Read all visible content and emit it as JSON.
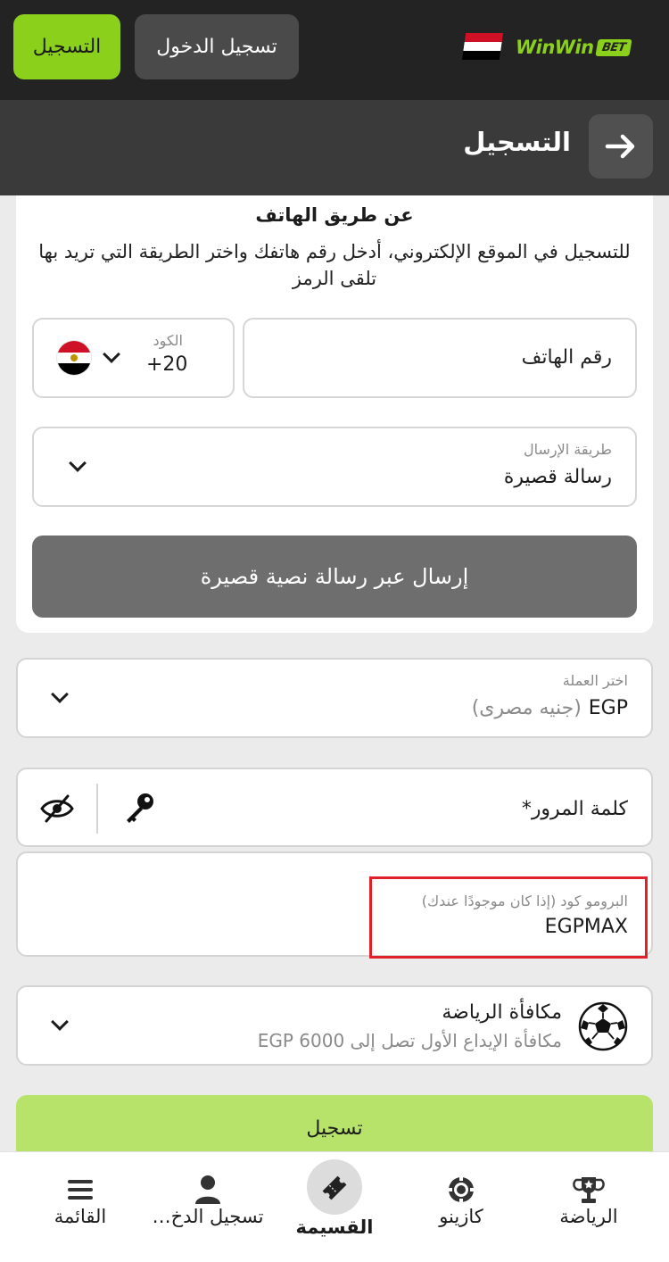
{
  "header": {
    "register_label": "التسجيل",
    "login_label": "تسجيل الدخول",
    "logo_text": "WinWin",
    "logo_badge": "BET",
    "flag_colors": [
      "#ce1126",
      "#ffffff",
      "#000000"
    ]
  },
  "titlebar": {
    "title": "التسجيل",
    "back_icon": "arrow-right-icon"
  },
  "card": {
    "heading": "عن طريق الهاتف",
    "description": "للتسجيل في الموقع الإلكتروني، أدخل رقم هاتفك واختر الطريقة التي تريد بها تلقى الرمز",
    "phone_placeholder": "رقم الهاتف",
    "code_label": "الكود",
    "code_value": "+20",
    "method_label": "طريقة الإرسال",
    "method_value": "رسالة قصيرة",
    "send_button": "إرسال عبر رسالة نصية قصيرة"
  },
  "currency": {
    "label": "اختر العملة",
    "code": "EGP",
    "name": "(جنيه مصرى)"
  },
  "password": {
    "placeholder": "كلمة المرور*",
    "key_icon": "key-icon",
    "eye_icon": "eye-off-icon"
  },
  "promo": {
    "label": "البرومو كود (إذا كان موجودًا عندك)",
    "value": "EGPMAX"
  },
  "bonus": {
    "title": "مكافأة الرياضة",
    "subtitle": "مكافأة الإيداع الأول تصل إلى EGP 6000",
    "icon": "soccer-ball-icon"
  },
  "register_button": "تسجيل",
  "bottom_nav": {
    "menu": "القائمة",
    "login": "تسجيل الدخ…",
    "coupon": "القسيمة",
    "casino": "كازينو",
    "sports": "الرياضة",
    "active": "coupon"
  },
  "colors": {
    "accent": "#8bd11c",
    "highlight": "#e0202a"
  }
}
